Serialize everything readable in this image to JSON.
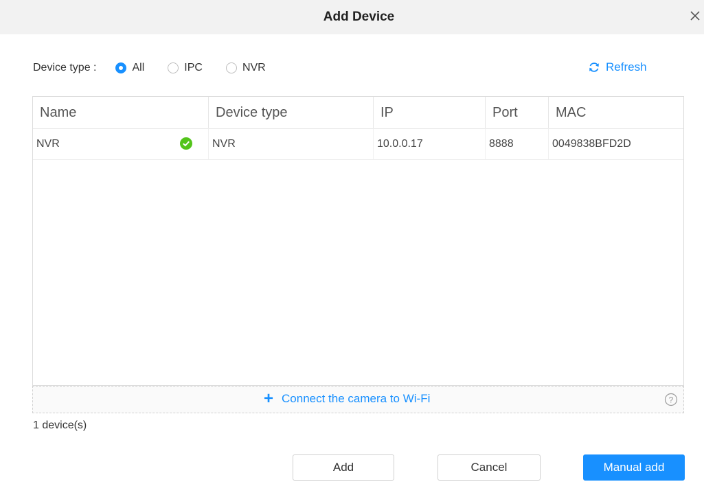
{
  "dialog": {
    "title": "Add Device",
    "close_icon": "close-icon"
  },
  "filter": {
    "label": "Device type :",
    "options": [
      {
        "label": "All",
        "checked": true
      },
      {
        "label": "IPC",
        "checked": false
      },
      {
        "label": "NVR",
        "checked": false
      }
    ]
  },
  "refresh": {
    "label": "Refresh",
    "icon": "refresh-icon"
  },
  "table": {
    "columns": [
      "Name",
      "Device type",
      "IP",
      "Port",
      "MAC"
    ],
    "rows": [
      {
        "name": "NVR",
        "status_icon": "check-circle-icon",
        "device_type": "NVR",
        "ip": "10.0.0.17",
        "port": "8888",
        "mac": "0049838BFD2D"
      }
    ]
  },
  "wifi": {
    "label": "Connect the camera to Wi-Fi",
    "icon": "plus-icon",
    "help_icon": "help-icon"
  },
  "footer": {
    "count": "1 device(s)",
    "add_label": "Add",
    "cancel_label": "Cancel",
    "manual_add_label": "Manual add"
  },
  "colors": {
    "accent": "#1890ff",
    "success": "#52c41a",
    "titlebar": "#f2f2f2"
  }
}
